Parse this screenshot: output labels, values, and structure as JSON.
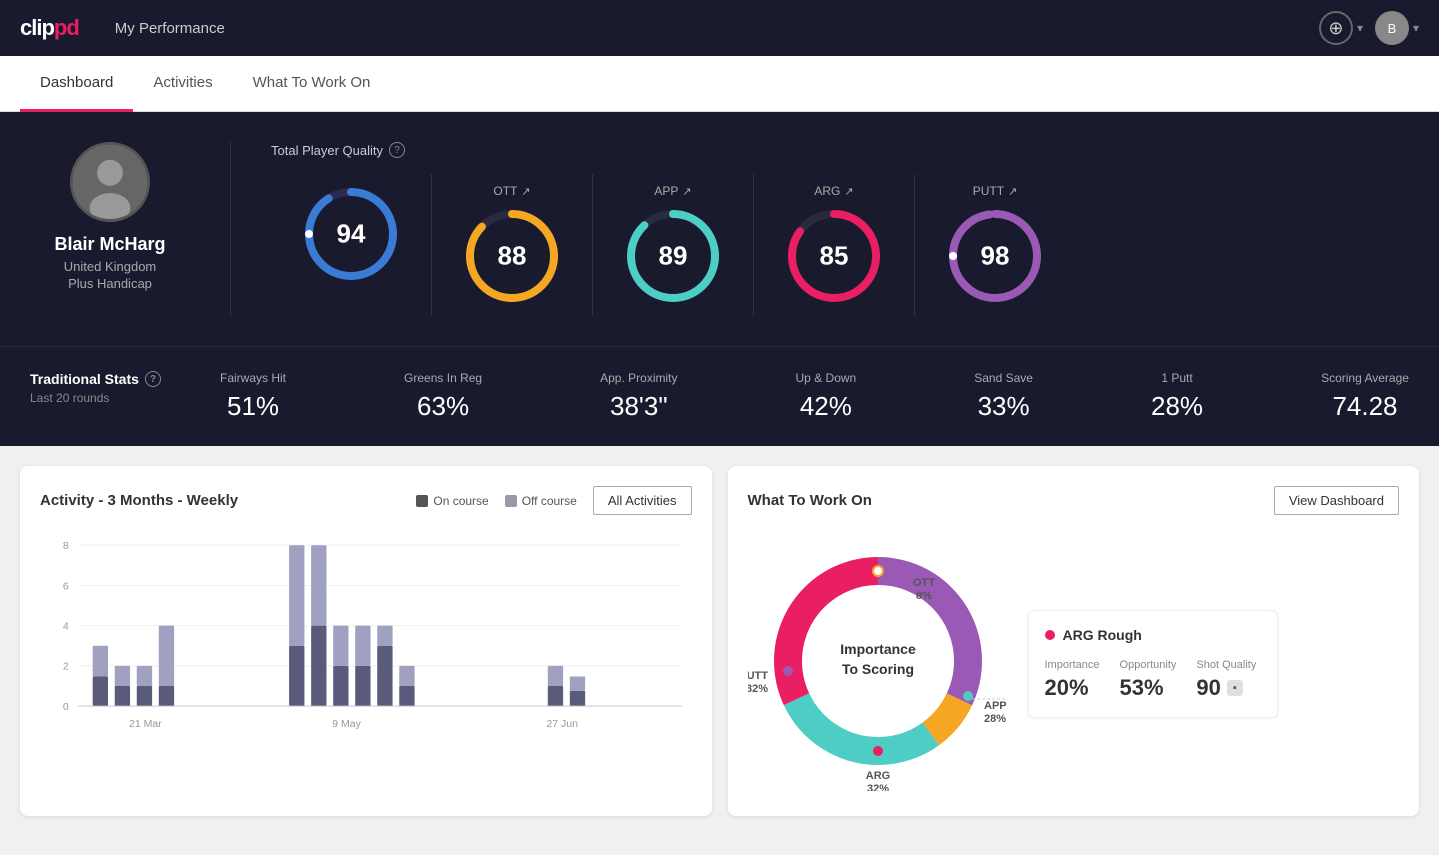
{
  "app": {
    "logo": "clippd",
    "nav_title": "My Performance"
  },
  "tabs": [
    {
      "id": "dashboard",
      "label": "Dashboard",
      "active": true
    },
    {
      "id": "activities",
      "label": "Activities",
      "active": false
    },
    {
      "id": "what_to_work_on",
      "label": "What To Work On",
      "active": false
    }
  ],
  "player": {
    "name": "Blair McHarg",
    "country": "United Kingdom",
    "handicap": "Plus Handicap",
    "avatar_initial": "B"
  },
  "total_quality": {
    "label": "Total Player Quality",
    "value": 94,
    "color": "#3a7bd5"
  },
  "score_cards": [
    {
      "label": "OTT",
      "value": 88,
      "color": "#f5a623",
      "arrow": "↗"
    },
    {
      "label": "APP",
      "value": 89,
      "color": "#4ecdc4",
      "arrow": "↗"
    },
    {
      "label": "ARG",
      "value": 85,
      "color": "#e91e63",
      "arrow": "↗"
    },
    {
      "label": "PUTT",
      "value": 98,
      "color": "#9b59b6",
      "arrow": "↗"
    }
  ],
  "traditional_stats": {
    "label": "Traditional Stats",
    "sublabel": "Last 20 rounds",
    "items": [
      {
        "label": "Fairways Hit",
        "value": "51%"
      },
      {
        "label": "Greens In Reg",
        "value": "63%"
      },
      {
        "label": "App. Proximity",
        "value": "38'3\""
      },
      {
        "label": "Up & Down",
        "value": "42%"
      },
      {
        "label": "Sand Save",
        "value": "33%"
      },
      {
        "label": "1 Putt",
        "value": "28%"
      },
      {
        "label": "Scoring Average",
        "value": "74.28"
      }
    ]
  },
  "activity_chart": {
    "title": "Activity - 3 Months - Weekly",
    "legend": [
      {
        "label": "On course",
        "color": "#555"
      },
      {
        "label": "Off course",
        "color": "#aac"
      }
    ],
    "all_activities_btn": "All Activities",
    "x_labels": [
      "21 Mar",
      "9 May",
      "27 Jun"
    ],
    "y_labels": [
      "0",
      "2",
      "4",
      "6",
      "8"
    ]
  },
  "what_to_work_on": {
    "title": "What To Work On",
    "view_dashboard_btn": "View Dashboard",
    "donut_center_line1": "Importance",
    "donut_center_line2": "To Scoring",
    "segments": [
      {
        "label": "OTT",
        "value": "8%",
        "color": "#f5a623"
      },
      {
        "label": "APP",
        "value": "28%",
        "color": "#4ecdc4"
      },
      {
        "label": "ARG",
        "value": "32%",
        "color": "#e91e63"
      },
      {
        "label": "PUTT",
        "value": "32%",
        "color": "#9b59b6"
      }
    ],
    "info_card": {
      "title": "ARG Rough",
      "dot_color": "#e91e63",
      "metrics": [
        {
          "label": "Importance",
          "value": "20%"
        },
        {
          "label": "Opportunity",
          "value": "53%"
        },
        {
          "label": "Shot Quality",
          "value": "90",
          "badge": "▪"
        }
      ]
    }
  },
  "icons": {
    "plus": "⊕",
    "chevron_down": "▾",
    "question": "?",
    "arrow_up_right": "↗"
  }
}
